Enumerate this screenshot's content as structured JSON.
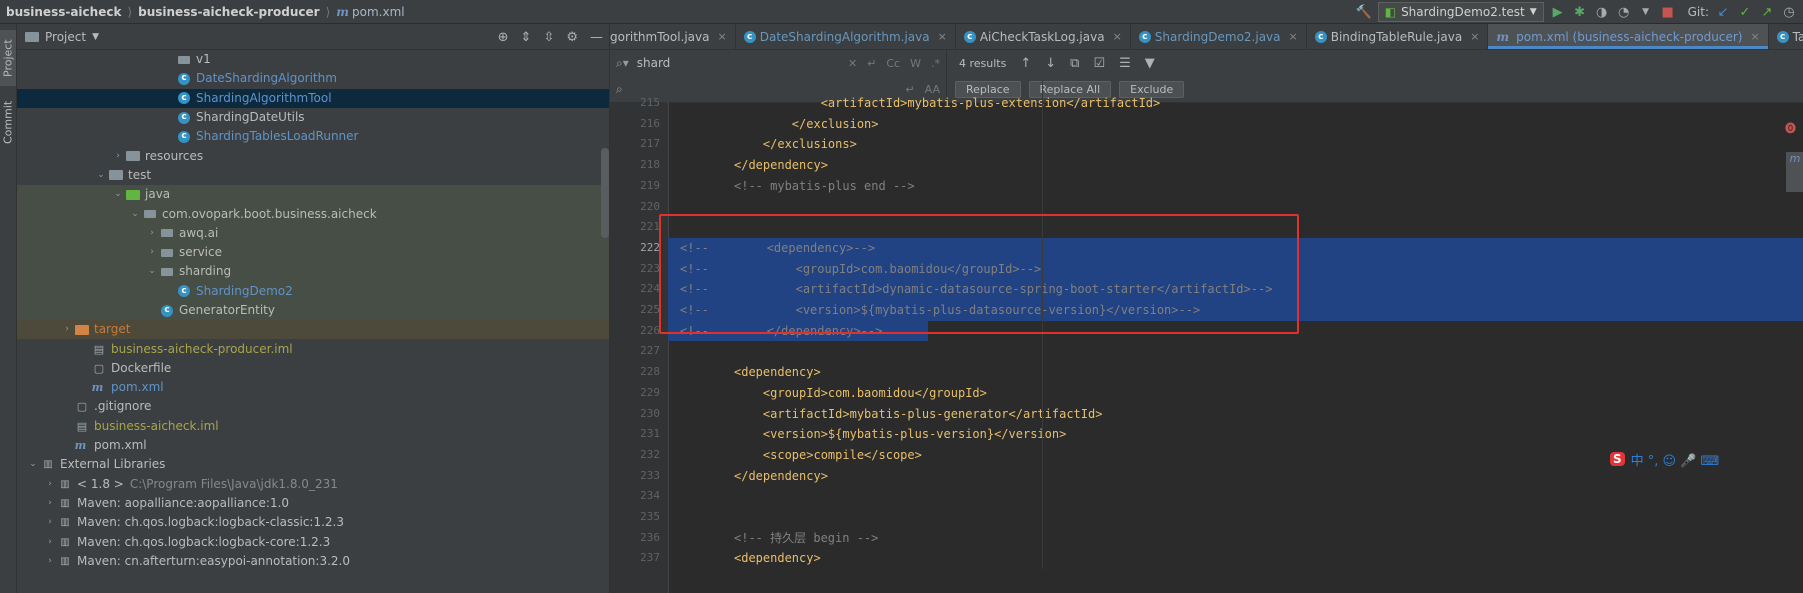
{
  "titlebar": {
    "project": "business-aicheck",
    "module": "business-aicheck-producer",
    "file": "pom.xml",
    "run_config": "ShardingDemo2.test",
    "git_label": "Git:"
  },
  "sidebar_tabs": [
    "Project",
    "Commit"
  ],
  "project_panel": {
    "title": "Project",
    "tree": [
      {
        "label": "v1",
        "indent": 9,
        "icon": "package",
        "arrow": "",
        "style": ""
      },
      {
        "label": "DateShardingAlgorithm",
        "indent": 9,
        "icon": "class",
        "arrow": "",
        "style": "blue"
      },
      {
        "label": "ShardingAlgorithmTool",
        "indent": 9,
        "icon": "class",
        "arrow": "",
        "style": "blue",
        "selected": true
      },
      {
        "label": "ShardingDateUtils",
        "indent": 9,
        "icon": "class",
        "arrow": "",
        "style": ""
      },
      {
        "label": "ShardingTablesLoadRunner",
        "indent": 9,
        "icon": "class",
        "arrow": "",
        "style": "blue"
      },
      {
        "label": "resources",
        "indent": 6,
        "icon": "folder",
        "arrow": "›",
        "style": ""
      },
      {
        "label": "test",
        "indent": 5,
        "icon": "folder",
        "arrow": "⌄",
        "style": ""
      },
      {
        "label": "java",
        "indent": 6,
        "icon": "folder-green",
        "arrow": "⌄",
        "style": "",
        "hl": "green"
      },
      {
        "label": "com.ovopark.boot.business.aicheck",
        "indent": 7,
        "icon": "package",
        "arrow": "⌄",
        "style": "",
        "hl": "green"
      },
      {
        "label": "awq.ai",
        "indent": 8,
        "icon": "package",
        "arrow": "›",
        "style": "",
        "hl": "green"
      },
      {
        "label": "service",
        "indent": 8,
        "icon": "package",
        "arrow": "›",
        "style": "",
        "hl": "green"
      },
      {
        "label": "sharding",
        "indent": 8,
        "icon": "package",
        "arrow": "⌄",
        "style": "",
        "hl": "green"
      },
      {
        "label": "ShardingDemo2",
        "indent": 9,
        "icon": "class-test",
        "arrow": "",
        "style": "blue",
        "hl": "green"
      },
      {
        "label": "GeneratorEntity",
        "indent": 8,
        "icon": "class-test",
        "arrow": "",
        "style": "",
        "hl": "green"
      },
      {
        "label": "target",
        "indent": 3,
        "icon": "folder-orange",
        "arrow": "›",
        "style": "orange",
        "hl": "orange"
      },
      {
        "label": "business-aicheck-producer.iml",
        "indent": 4,
        "icon": "iml",
        "arrow": "",
        "style": "olive"
      },
      {
        "label": "Dockerfile",
        "indent": 4,
        "icon": "file",
        "arrow": "",
        "style": ""
      },
      {
        "label": "pom.xml",
        "indent": 4,
        "icon": "maven",
        "arrow": "",
        "style": "blue"
      },
      {
        "label": ".gitignore",
        "indent": 3,
        "icon": "file",
        "arrow": "",
        "style": ""
      },
      {
        "label": "business-aicheck.iml",
        "indent": 3,
        "icon": "iml",
        "arrow": "",
        "style": "olive"
      },
      {
        "label": "pom.xml",
        "indent": 3,
        "icon": "maven",
        "arrow": "",
        "style": ""
      },
      {
        "label": "External Libraries",
        "indent": 1,
        "icon": "lib",
        "arrow": "⌄",
        "style": ""
      },
      {
        "label": "< 1.8 >",
        "suffix": "C:\\Program Files\\Java\\jdk1.8.0_231",
        "indent": 2,
        "icon": "lib",
        "arrow": "›",
        "style": ""
      },
      {
        "label": "Maven: aopalliance:aopalliance:1.0",
        "indent": 2,
        "icon": "lib",
        "arrow": "›",
        "style": ""
      },
      {
        "label": "Maven: ch.qos.logback:logback-classic:1.2.3",
        "indent": 2,
        "icon": "lib",
        "arrow": "›",
        "style": ""
      },
      {
        "label": "Maven: ch.qos.logback:logback-core:1.2.3",
        "indent": 2,
        "icon": "lib",
        "arrow": "›",
        "style": ""
      },
      {
        "label": "Maven: cn.afterturn:easypoi-annotation:3.2.0",
        "indent": 2,
        "icon": "lib",
        "arrow": "›",
        "style": ""
      }
    ]
  },
  "tabs": [
    {
      "label": "gorithmTool.java",
      "icon": "class"
    },
    {
      "label": "DateShardingAlgorithm.java",
      "icon": "class",
      "blue": true
    },
    {
      "label": "AiCheckTaskLog.java",
      "icon": "class"
    },
    {
      "label": "ShardingDemo2.java",
      "icon": "class-test",
      "blue": true
    },
    {
      "label": "BindingTableRule.java",
      "icon": "class-lib"
    },
    {
      "label": "pom.xml (business-aicheck-producer)",
      "icon": "maven",
      "active": true
    },
    {
      "label": "TableRu",
      "icon": "class-lib"
    }
  ],
  "search": {
    "query": "shard",
    "results": "4 results",
    "replace_label": "Replace",
    "replace_all_label": "Replace All",
    "exclude_label": "Exclude"
  },
  "code_lines": [
    {
      "n": "215",
      "html": "            <artifactId>mybatis-plus-extension</artifactId>",
      "kind": "xml"
    },
    {
      "n": "216",
      "html": "        </exclusion>",
      "kind": "xml"
    },
    {
      "n": "217",
      "html": "    </exclusions>",
      "kind": "xml"
    },
    {
      "n": "218",
      "html": "</dependency>",
      "kind": "xml"
    },
    {
      "n": "219",
      "html": "<!-- mybatis-plus end -->",
      "kind": "comment"
    },
    {
      "n": "220",
      "html": "",
      "kind": "xml"
    },
    {
      "n": "221",
      "html": "",
      "kind": "xml"
    },
    {
      "n": "222",
      "html": "<!--        <dependency>-->",
      "kind": "selcomment"
    },
    {
      "n": "223",
      "html": "<!--            <groupId>com.baomidou</groupId>-->",
      "kind": "selcomment"
    },
    {
      "n": "224",
      "html": "<!--            <artifactId>dynamic-datasource-spring-boot-starter</artifactId>-->",
      "kind": "selcomment"
    },
    {
      "n": "225",
      "html": "<!--            <version>${mybatis-plus-datasource-version}</version>-->",
      "kind": "selcomment"
    },
    {
      "n": "226",
      "html": "<!--        </dependency>-->",
      "kind": "selcomment"
    },
    {
      "n": "227",
      "html": "",
      "kind": "xml"
    },
    {
      "n": "228",
      "html": "<dependency>",
      "kind": "xml"
    },
    {
      "n": "229",
      "html": "    <groupId>com.baomidou</groupId>",
      "kind": "xml"
    },
    {
      "n": "230",
      "html": "    <artifactId>mybatis-plus-generator</artifactId>",
      "kind": "xml"
    },
    {
      "n": "231",
      "html": "    <version>${mybatis-plus-version}</version>",
      "kind": "xml"
    },
    {
      "n": "232",
      "html": "    <scope>compile</scope>",
      "kind": "xml"
    },
    {
      "n": "233",
      "html": "</dependency>",
      "kind": "xml"
    },
    {
      "n": "234",
      "html": "",
      "kind": "xml"
    },
    {
      "n": "235",
      "html": "",
      "kind": "xml"
    },
    {
      "n": "236",
      "html": "<!-- 持久层 begin -->",
      "kind": "comment"
    },
    {
      "n": "237",
      "html": "<dependency>",
      "kind": "xml"
    }
  ],
  "ime": {
    "logo": "S",
    "text": "中 °, ☺ 🎤 ⌨"
  },
  "colors": {
    "accent": "#4a88c7",
    "selection": "#214283",
    "red_box": "#e0312b"
  }
}
